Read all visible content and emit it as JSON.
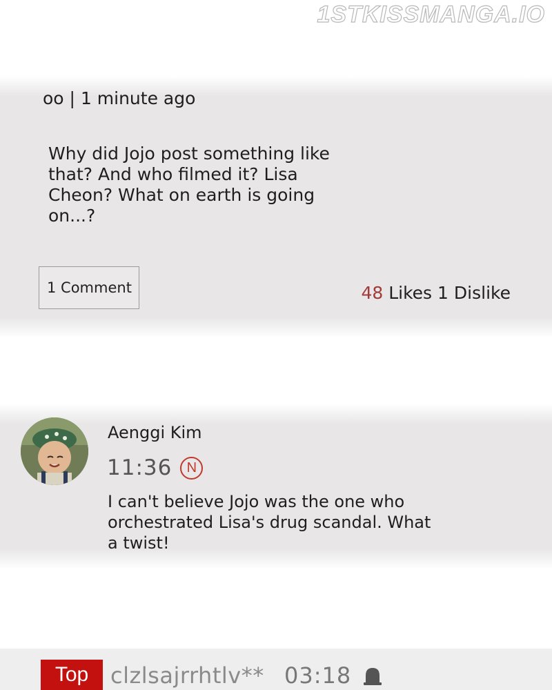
{
  "watermark": "1STKISSMANGA.IO",
  "post": {
    "author": "oo",
    "separator": "|",
    "time": "1 minute ago",
    "body": "Why did Jojo post something like that? And who filmed it? Lisa Cheon? What on earth is going on...?",
    "comment_button_label": "1 Comment",
    "likes_count": "48",
    "likes_label": "Likes",
    "dislikes_count": "1",
    "dislikes_label": "Dislike",
    "likes_color": "#a23a3a"
  },
  "reply": {
    "author": "Aenggi Kim",
    "time": "11:36",
    "new_badge": "N",
    "body": "I can't believe Jojo was the one who orchestrated Lisa's drug scandal. What a twist!",
    "avatar_icon": "child-photo-avatar"
  },
  "bottom": {
    "top_label": "Top",
    "user_id": "clzlsajrrhtlv**",
    "time": "03:18",
    "icon": "bell-icon",
    "accent": "#c3110f"
  }
}
